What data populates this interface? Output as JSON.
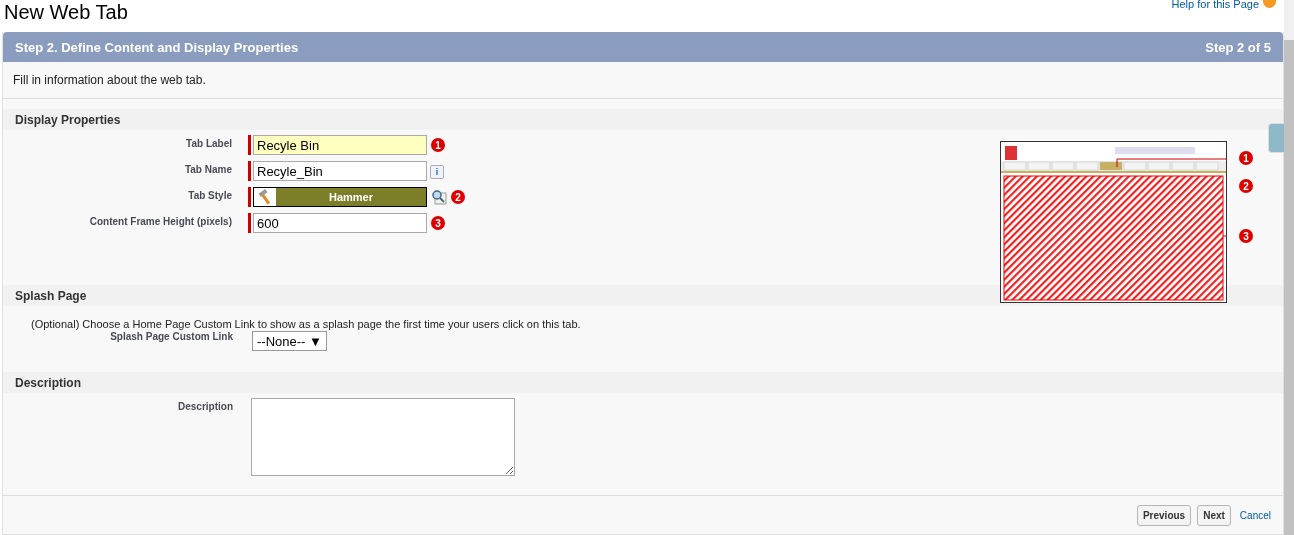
{
  "page_title": "New Web Tab",
  "help_link": "Help for this Page",
  "step_header": {
    "title": "Step 2. Define Content and Display Properties",
    "progress": "Step 2 of 5"
  },
  "intro": "Fill in information about the web tab.",
  "display_properties": {
    "heading": "Display Properties",
    "fields": [
      {
        "kind": "text",
        "label": "Tab Label",
        "value": "Recyle Bin",
        "highlighted": true,
        "marker": "1"
      },
      {
        "kind": "info",
        "label": "Tab Name",
        "value": "Recyle_Bin",
        "highlighted": false,
        "button": "i"
      },
      {
        "kind": "style",
        "label": "Tab Style",
        "value": "Hammer",
        "marker": "2"
      },
      {
        "kind": "text",
        "label": "Content Frame Height (pixels)",
        "value": "600",
        "highlighted": false,
        "marker": "3"
      }
    ],
    "preview_markers": [
      "1",
      "2",
      "3"
    ]
  },
  "splash_page": {
    "heading": "Splash Page",
    "note": "(Optional) Choose a Home Page Custom Link to show as a splash page the first time your users click on this tab.",
    "label": "Splash Page Custom Link",
    "value": "--None--",
    "arrow": "▼"
  },
  "description": {
    "heading": "Description",
    "label": "Description"
  },
  "footer": {
    "buttons": [
      "Previous",
      "Next"
    ],
    "link": "Cancel"
  }
}
